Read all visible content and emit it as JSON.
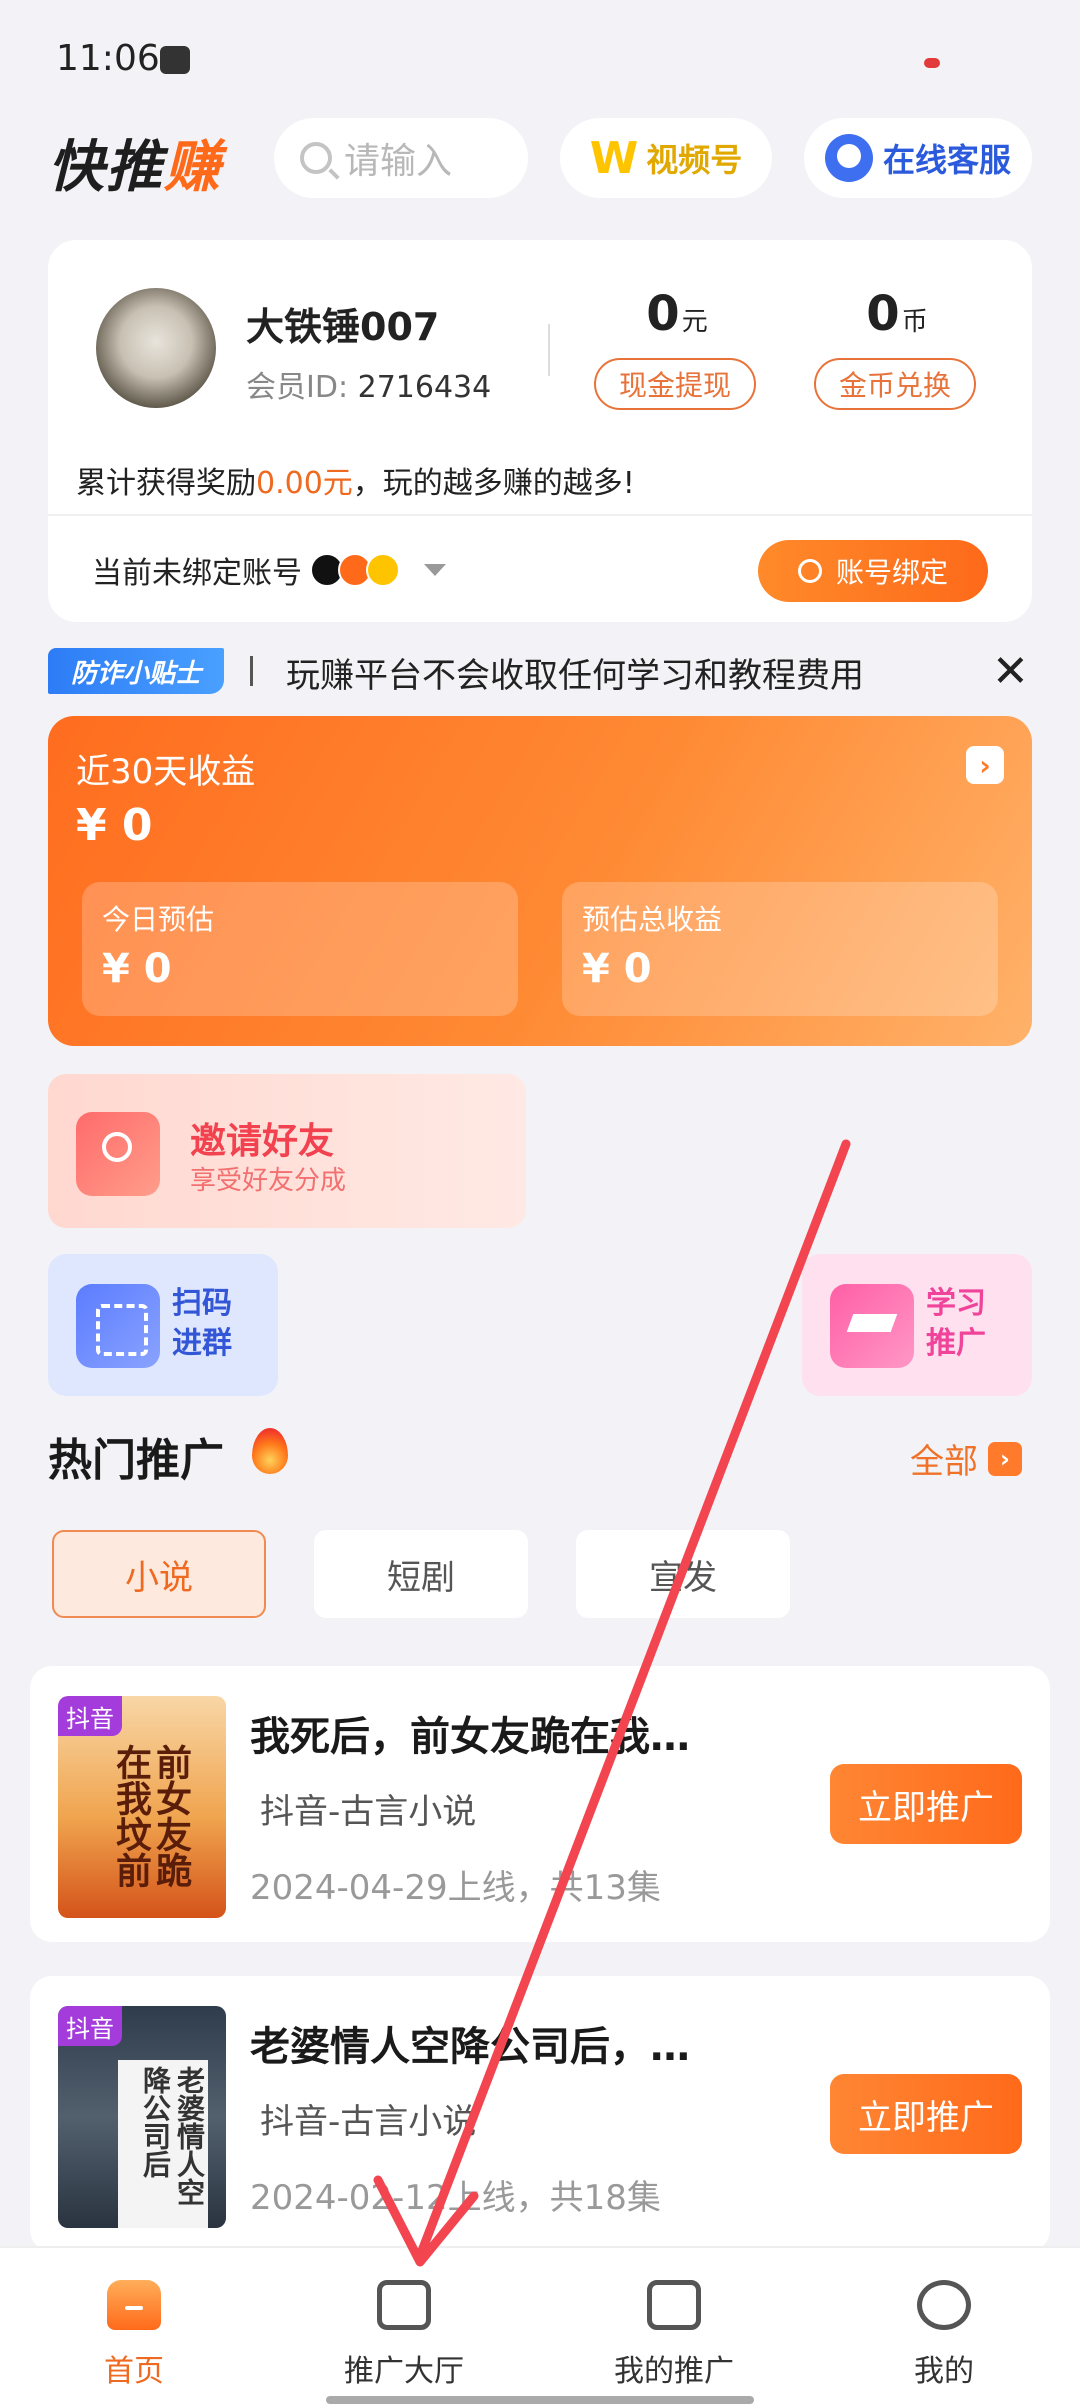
{
  "status": {
    "time": "11:06"
  },
  "header": {
    "logo_text_a": "快推",
    "logo_text_b": "赚",
    "search_placeholder": "请输入",
    "video_label": "视频号",
    "service_label": "在线客服"
  },
  "profile": {
    "username": "大铁锤007",
    "member_id_label": "会员ID:",
    "member_id": "2716434",
    "cash_amount": "0",
    "cash_unit": "元",
    "coin_amount": "0",
    "coin_unit": "币",
    "cash_button": "现金提现",
    "coin_button": "金币兑换",
    "reward_prefix": "累计获得奖励",
    "reward_value": "0.00元",
    "reward_suffix": "，玩的越多赚的越多!",
    "unbound_text": "当前未绑定账号",
    "bind_button": "账号绑定"
  },
  "tip": {
    "badge": "防诈小贴士",
    "text": "玩赚平台不会收取任何学习和教程费用",
    "close": "✕"
  },
  "earnings": {
    "title": "近30天收益",
    "value": "¥ 0",
    "arrow": "›",
    "today_label": "今日预估",
    "today_value": "¥ 0",
    "total_label": "预估总收益",
    "total_value": "¥ 0"
  },
  "actions": {
    "invite_title": "邀请好友",
    "invite_sub": "享受好友分成",
    "scan_title": "扫码进群",
    "learn_title": "学习推广"
  },
  "hot": {
    "title": "热门推广",
    "all_label": "全部",
    "all_arrow": "›",
    "tabs": [
      "小说",
      "短剧",
      "宣发"
    ]
  },
  "items": [
    {
      "tag": "抖音",
      "cover_title": "前女友跪在我坟前",
      "title": "我死后，前女友跪在我…",
      "category": "抖音-古言小说",
      "date": "2024-04-29上线，共13集",
      "button": "立即推广"
    },
    {
      "tag": "抖音",
      "cover_title": "老婆情人空降公司后",
      "title": "老婆情人空降公司后，…",
      "category": "抖音-古言小说",
      "date": "2024-02-12上线，共18集",
      "button": "立即推广"
    }
  ],
  "tabbar": [
    {
      "label": "首页",
      "icon": "home-icon"
    },
    {
      "label": "推广大厅",
      "icon": "sofa-icon"
    },
    {
      "label": "我的推广",
      "icon": "promo-screen-icon"
    },
    {
      "label": "我的",
      "icon": "smile-face-icon"
    }
  ],
  "colors": {
    "accent": "#ff6a1a",
    "annotation_arrow": "#f2454f"
  }
}
